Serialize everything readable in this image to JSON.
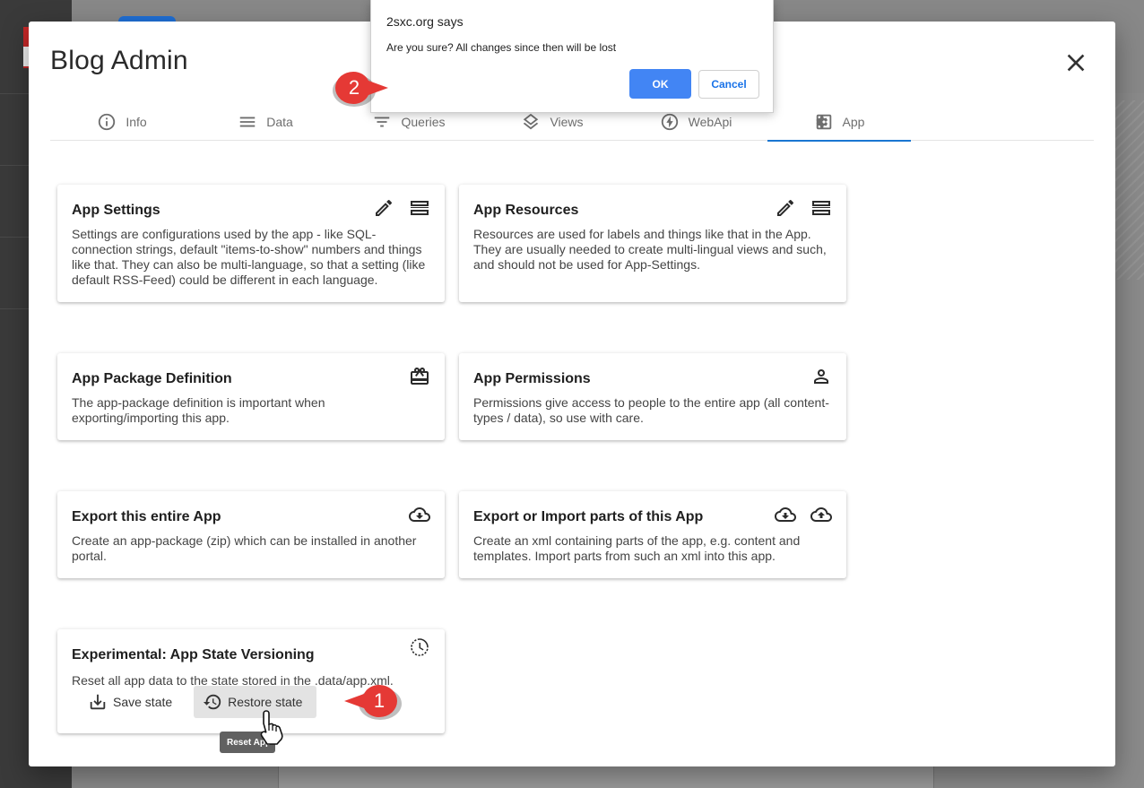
{
  "dialog": {
    "title": "Blog Admin",
    "close_icon": "close-icon"
  },
  "tabs": [
    {
      "label": "Info",
      "icon": "info-icon"
    },
    {
      "label": "Data",
      "icon": "menu-lines-icon"
    },
    {
      "label": "Queries",
      "icon": "filter-icon"
    },
    {
      "label": "Views",
      "icon": "layers-icon"
    },
    {
      "label": "WebApi",
      "icon": "lightning-icon"
    },
    {
      "label": "App",
      "icon": "gear-box-icon",
      "active": true
    }
  ],
  "cards": {
    "app_settings": {
      "title": "App Settings",
      "description": "Settings are configurations used by the app - like SQL-connection strings, default \"items-to-show\" numbers and things like that. They can also be multi-language, so that a setting (like default RSS-Feed) could be different in each language.",
      "icons": [
        "edit-pencil-icon",
        "list-storage-icon"
      ]
    },
    "app_resources": {
      "title": "App Resources",
      "description": "Resources are used for labels and things like that in the App. They are usually needed to create multi-lingual views and such, and should not be used for App-Settings.",
      "icons": [
        "edit-pencil-icon",
        "list-storage-icon"
      ]
    },
    "app_package": {
      "title": "App Package Definition",
      "description": "The app-package definition is important when exporting/importing this app.",
      "icons": [
        "package-icon"
      ]
    },
    "app_permissions": {
      "title": "App Permissions",
      "description": "Permissions give access to people to the entire app (all content-types / data), so use with care.",
      "icons": [
        "person-icon"
      ]
    },
    "export_app": {
      "title": "Export this entire App",
      "description": "Create an app-package (zip) which can be installed in another portal.",
      "icons": [
        "cloud-download-icon"
      ]
    },
    "export_import_parts": {
      "title": "Export or Import parts of this App",
      "description": "Create an xml containing parts of the app, e.g. content and templates. Import parts from such an xml into this app.",
      "icons": [
        "cloud-download-icon",
        "cloud-upload-icon"
      ]
    },
    "app_state": {
      "title": "Experimental: App State Versioning",
      "description": "Reset all app data to the state stored in the .data/app.xml.",
      "icons": [
        "history-clock-icon"
      ],
      "save_label": "Save state",
      "restore_label": "Restore state"
    }
  },
  "tooltip": {
    "text": "Reset App"
  },
  "alert": {
    "title": "2sxc.org says",
    "message": "Are you sure? All changes since then will be lost",
    "ok_label": "OK",
    "cancel_label": "Cancel"
  },
  "markers": [
    {
      "number": "1",
      "color": "#e53935"
    },
    {
      "number": "2",
      "color": "#e53935"
    }
  ],
  "colors": {
    "accent": "#1976d2",
    "alert_ok": "#4285f4",
    "marker": "#e53935"
  }
}
